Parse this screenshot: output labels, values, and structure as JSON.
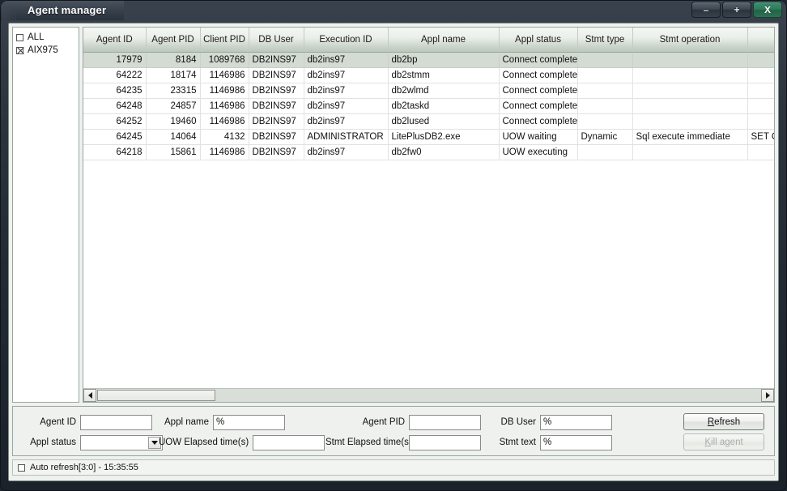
{
  "window": {
    "title": "Agent manager",
    "buttons": {
      "minimize": "–",
      "maximize": "+",
      "close": "X"
    }
  },
  "tree": {
    "items": [
      {
        "label": "ALL",
        "state": "unchecked"
      },
      {
        "label": "AIX975",
        "state": "crossed"
      }
    ]
  },
  "grid": {
    "columns": [
      "Agent ID",
      "Agent PID",
      "Client PID",
      "DB User",
      "Execution ID",
      "Appl name",
      "Appl status",
      "Stmt type",
      "Stmt operation",
      ""
    ],
    "rows": [
      {
        "selected": true,
        "cells": [
          "17979",
          "8184",
          "1089768",
          "DB2INS97",
          "db2ins97",
          "db2bp",
          "Connect completed",
          "",
          "",
          ""
        ]
      },
      {
        "selected": false,
        "cells": [
          "64222",
          "18174",
          "1146986",
          "DB2INS97",
          "db2ins97",
          "db2stmm",
          "Connect completed",
          "",
          "",
          ""
        ]
      },
      {
        "selected": false,
        "cells": [
          "64235",
          "23315",
          "1146986",
          "DB2INS97",
          "db2ins97",
          "db2wlmd",
          "Connect completed",
          "",
          "",
          ""
        ]
      },
      {
        "selected": false,
        "cells": [
          "64248",
          "24857",
          "1146986",
          "DB2INS97",
          "db2ins97",
          "db2taskd",
          "Connect completed",
          "",
          "",
          ""
        ]
      },
      {
        "selected": false,
        "cells": [
          "64252",
          "19460",
          "1146986",
          "DB2INS97",
          "db2ins97",
          "db2lused",
          "Connect completed",
          "",
          "",
          ""
        ]
      },
      {
        "selected": false,
        "cells": [
          "64245",
          "14064",
          "4132",
          "DB2INS97",
          "ADMINISTRATOR",
          "LitePlusDB2.exe",
          "UOW waiting",
          "Dynamic",
          "Sql execute immediate",
          "SET CUR"
        ]
      },
      {
        "selected": false,
        "cells": [
          "64218",
          "15861",
          "1146986",
          "DB2INS97",
          "db2ins97",
          "db2fw0",
          "UOW executing",
          "",
          "",
          ""
        ]
      }
    ]
  },
  "filters": {
    "agent_id": {
      "label": "Agent ID",
      "value": ""
    },
    "appl_status": {
      "label": "Appl status",
      "value": ""
    },
    "appl_name": {
      "label": "Appl name",
      "value": "%"
    },
    "uow_elapsed": {
      "label": "UOW Elapsed time(s)",
      "value": ""
    },
    "agent_pid": {
      "label": "Agent PID",
      "value": ""
    },
    "stmt_elapsed": {
      "label": "Stmt Elapsed time(s)",
      "value": ""
    },
    "db_user": {
      "label": "DB User",
      "value": "%"
    },
    "stmt_text": {
      "label": "Stmt text",
      "value": "%"
    }
  },
  "actions": {
    "refresh": {
      "mnemonic": "R",
      "rest": "efresh"
    },
    "kill_agent": {
      "mnemonic": "K",
      "rest": "ill agent",
      "enabled": false
    }
  },
  "statusbar": {
    "text": "Auto refresh[3:0] - 15:35:55",
    "auto_refresh_checked": false
  },
  "colors": {
    "titlebar": "#2c343d",
    "close_button": "#2f7a5c",
    "selected_row": "#d3dbd2",
    "client_bg": "#eef1ee"
  }
}
